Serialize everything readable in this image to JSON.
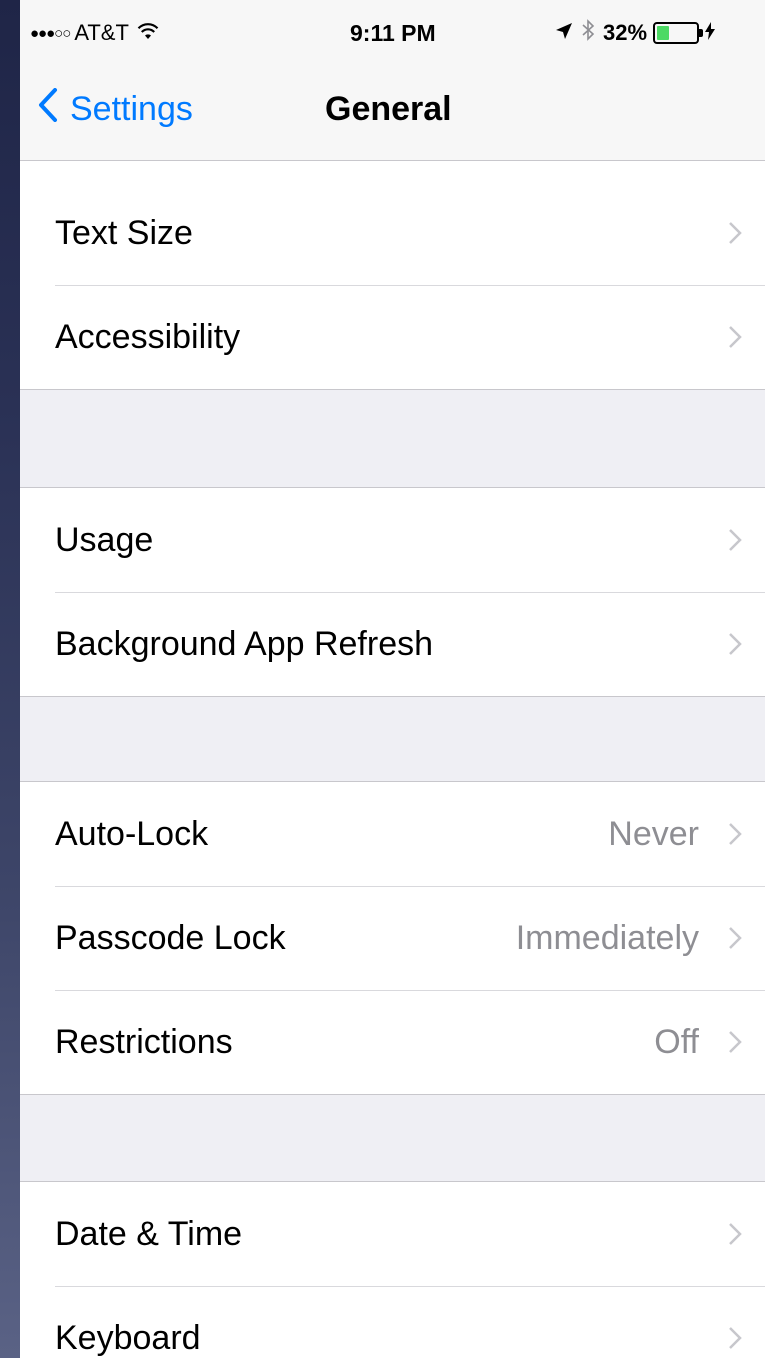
{
  "status_bar": {
    "carrier": "AT&T",
    "time": "9:11 PM",
    "battery_percent": "32%",
    "battery_level": 0.32,
    "signal_icon": "signal-dots-icon",
    "wifi_icon": "wifi-icon"
  },
  "nav": {
    "back_label": "Settings",
    "title": "General"
  },
  "colors": {
    "accent": "#007aff",
    "battery_fill": "#4cd964",
    "group_background": "#efeff4",
    "secondary_text": "#8e8e93"
  },
  "groups": [
    {
      "rows": [
        {
          "label": "Text Size",
          "value": ""
        },
        {
          "label": "Accessibility",
          "value": ""
        }
      ]
    },
    {
      "rows": [
        {
          "label": "Usage",
          "value": ""
        },
        {
          "label": "Background App Refresh",
          "value": ""
        }
      ]
    },
    {
      "rows": [
        {
          "label": "Auto-Lock",
          "value": "Never"
        },
        {
          "label": "Passcode Lock",
          "value": "Immediately"
        },
        {
          "label": "Restrictions",
          "value": "Off"
        }
      ]
    },
    {
      "rows": [
        {
          "label": "Date & Time",
          "value": ""
        },
        {
          "label": "Keyboard",
          "value": ""
        }
      ]
    }
  ]
}
